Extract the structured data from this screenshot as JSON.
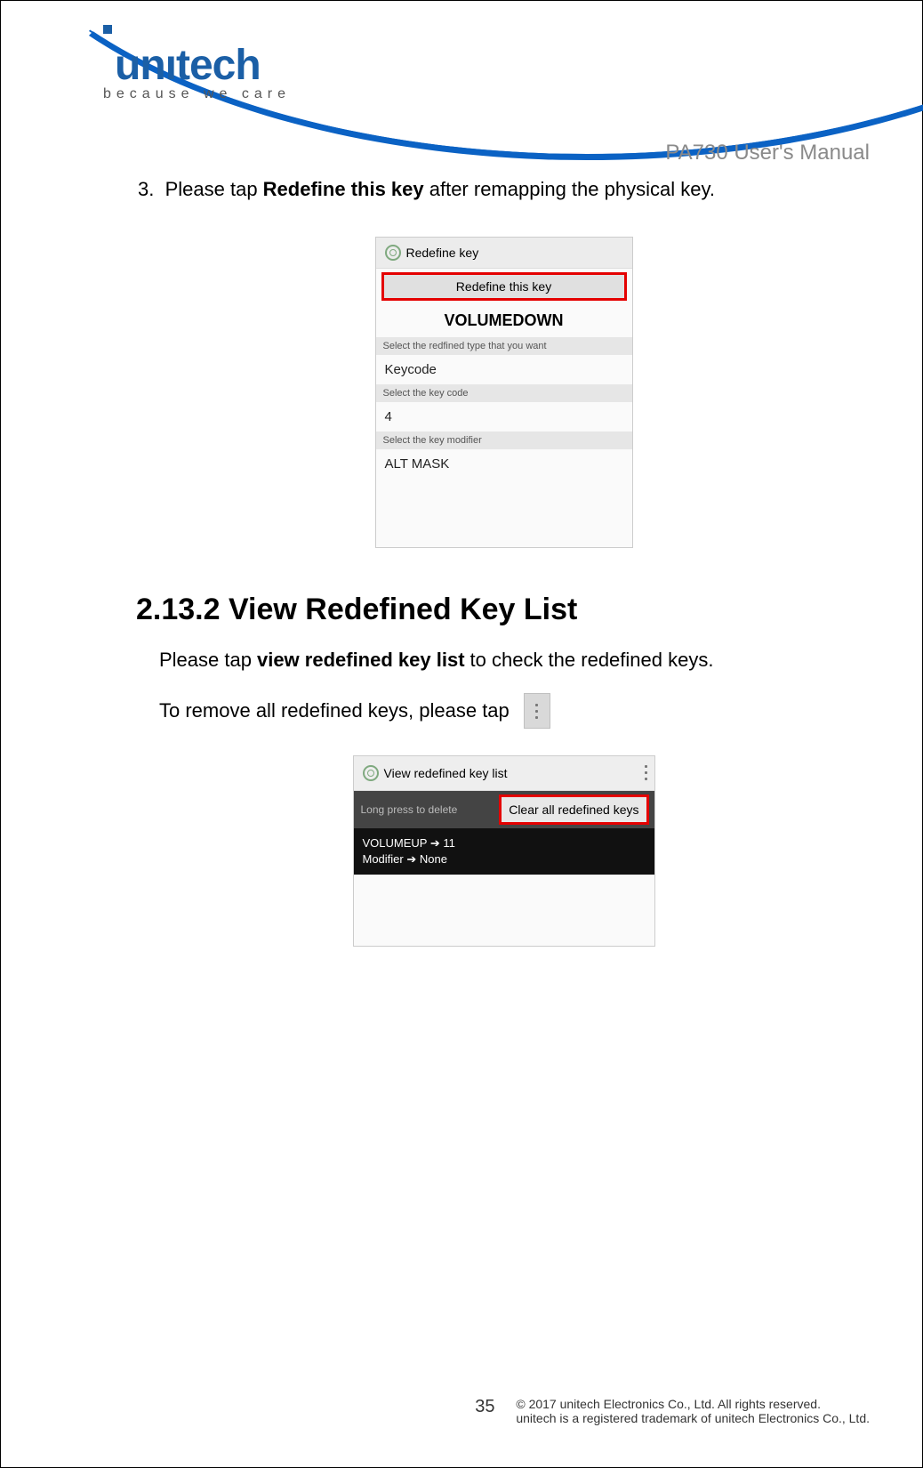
{
  "header": {
    "logo_text": "unıtech",
    "logo_tagline": "because we care",
    "doc_title": "PA730 User's Manual"
  },
  "step": {
    "number": "3.",
    "prefix": "Please tap ",
    "bold": "Redefine this key",
    "suffix": " after remapping the physical key."
  },
  "shot1": {
    "title": "Redefine key",
    "button": "Redefine this key",
    "selected_key": "VOLUMEDOWN",
    "label_type": "Select the redfined type that you want",
    "value_type": "Keycode",
    "label_code": "Select the key code",
    "value_code": "4",
    "label_mod": "Select the key modifier",
    "value_mod": "ALT MASK"
  },
  "section": {
    "heading": "2.13.2 View Redefined Key List",
    "line1_pre": "Please tap ",
    "line1_bold": "view redefined key list",
    "line1_post": " to check the redefined keys.",
    "line2": "To remove all redefined keys, please tap"
  },
  "shot2": {
    "title": "View redefined key list",
    "hint": "Long press to delete",
    "clear": "Clear all redefined keys",
    "map_line1_a": "VOLUMEUP",
    "map_line1_b": "11",
    "map_line2_a": "Modifier",
    "map_line2_b": "None"
  },
  "footer": {
    "page": "35",
    "line1": "© 2017 unitech Electronics Co., Ltd. All rights reserved.",
    "line2": "unitech is a registered trademark of unitech Electronics Co., Ltd."
  }
}
